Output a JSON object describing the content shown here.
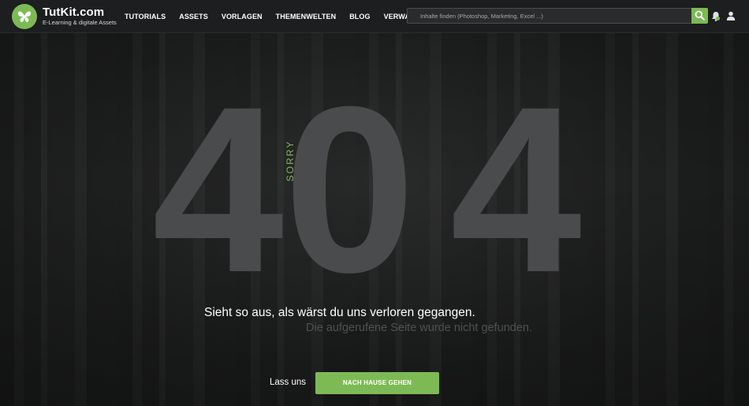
{
  "header": {
    "brand_name": "TutKit.com",
    "brand_tagline": "E-Learning & digitale Assets",
    "logo_icon": "butterfly-icon",
    "nav": [
      {
        "label": "TUTORIALS"
      },
      {
        "label": "ASSETS"
      },
      {
        "label": "VORLAGEN"
      },
      {
        "label": "THEMENWELTEN"
      },
      {
        "label": "BLOG"
      },
      {
        "label": "VERWALTUNG"
      }
    ],
    "search": {
      "placeholder": "Inhalte finden (Photoshop, Marketing, Excel ...)",
      "value": "",
      "button_icon": "search-icon"
    },
    "notification_icon": "bell-icon",
    "user_icon": "user-icon"
  },
  "error": {
    "code_digits": [
      "4",
      "0",
      "4"
    ],
    "sorry": "SORRY",
    "headline": "Sieht so aus, als wärst du uns verloren gegangen.",
    "subline": "Die aufgerufene Seite wurde nicht gefunden.",
    "lets_label": "Lass uns",
    "home_button_label": "NACH HAUSE GEHEN"
  },
  "colors": {
    "accent": "#7dba55",
    "header_bg": "#1d1e1f",
    "digits": "#4a4b4c"
  }
}
